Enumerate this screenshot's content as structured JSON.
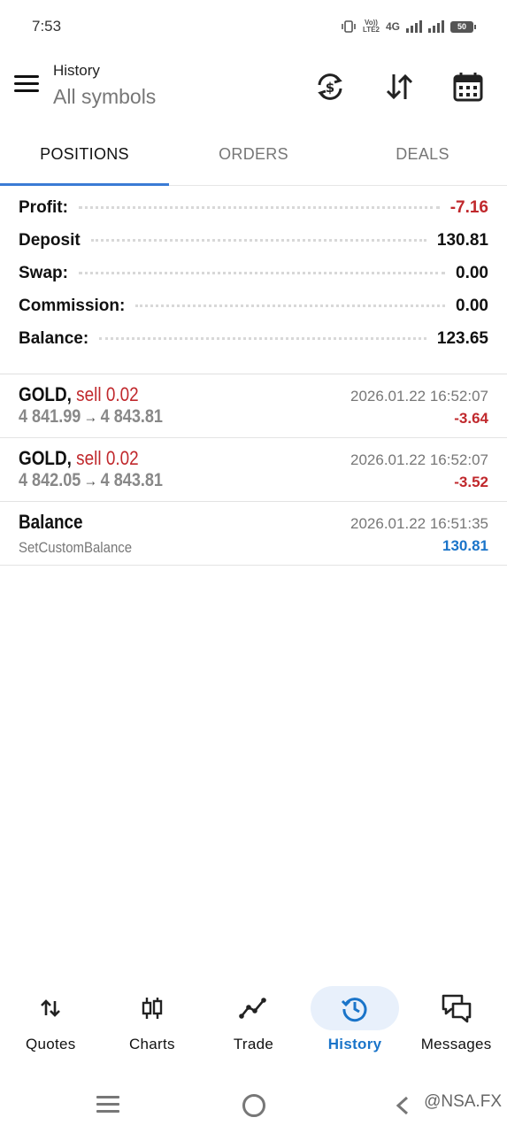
{
  "status_bar": {
    "time": "7:53",
    "volte_line1": "Vo))",
    "volte_line2": "LTE2",
    "network": "4G",
    "battery": "50"
  },
  "app_bar": {
    "title_small": "History",
    "title_main": "All symbols",
    "icons": [
      "menu-icon",
      "currency-exchange-icon",
      "sort-icon",
      "calendar-icon"
    ]
  },
  "tabs": [
    {
      "label": "POSITIONS",
      "active": true
    },
    {
      "label": "ORDERS",
      "active": false
    },
    {
      "label": "DEALS",
      "active": false
    }
  ],
  "summary": {
    "profit": {
      "label": "Profit:",
      "value": "-7.16"
    },
    "deposit": {
      "label": "Deposit",
      "value": "130.81"
    },
    "swap": {
      "label": "Swap:",
      "value": "0.00"
    },
    "commission": {
      "label": "Commission:",
      "value": "0.00"
    },
    "balance": {
      "label": "Balance:",
      "value": "123.65"
    }
  },
  "items": [
    {
      "symbol": "GOLD,",
      "side": "sell 0.02",
      "open": "4 841.99",
      "arrow": "→",
      "close": "4 843.81",
      "date": "2026.01.22 16:52:07",
      "pl": "-3.64"
    },
    {
      "symbol": "GOLD,",
      "side": "sell 0.02",
      "open": "4 842.05",
      "arrow": "→",
      "close": "4 843.81",
      "date": "2026.01.22 16:52:07",
      "pl": "-3.52"
    },
    {
      "symbol": "Balance",
      "comment": "SetCustomBalance",
      "date": "2026.01.22 16:51:35",
      "pl": "130.81"
    }
  ],
  "bottom_nav": [
    {
      "label": "Quotes",
      "icon": "quotes-arrows-icon",
      "active": false
    },
    {
      "label": "Charts",
      "icon": "candlestick-icon",
      "active": false
    },
    {
      "label": "Trade",
      "icon": "trade-line-icon",
      "active": false
    },
    {
      "label": "History",
      "icon": "history-clock-icon",
      "active": true
    },
    {
      "label": "Messages",
      "icon": "chat-bubbles-icon",
      "active": false
    }
  ],
  "watermark": "@NSA.FX",
  "colors": {
    "loss": "#c0282c",
    "gain": "#1a74c9",
    "accent": "#3a7bd5",
    "nav_active_bg": "#e8f0fb"
  }
}
